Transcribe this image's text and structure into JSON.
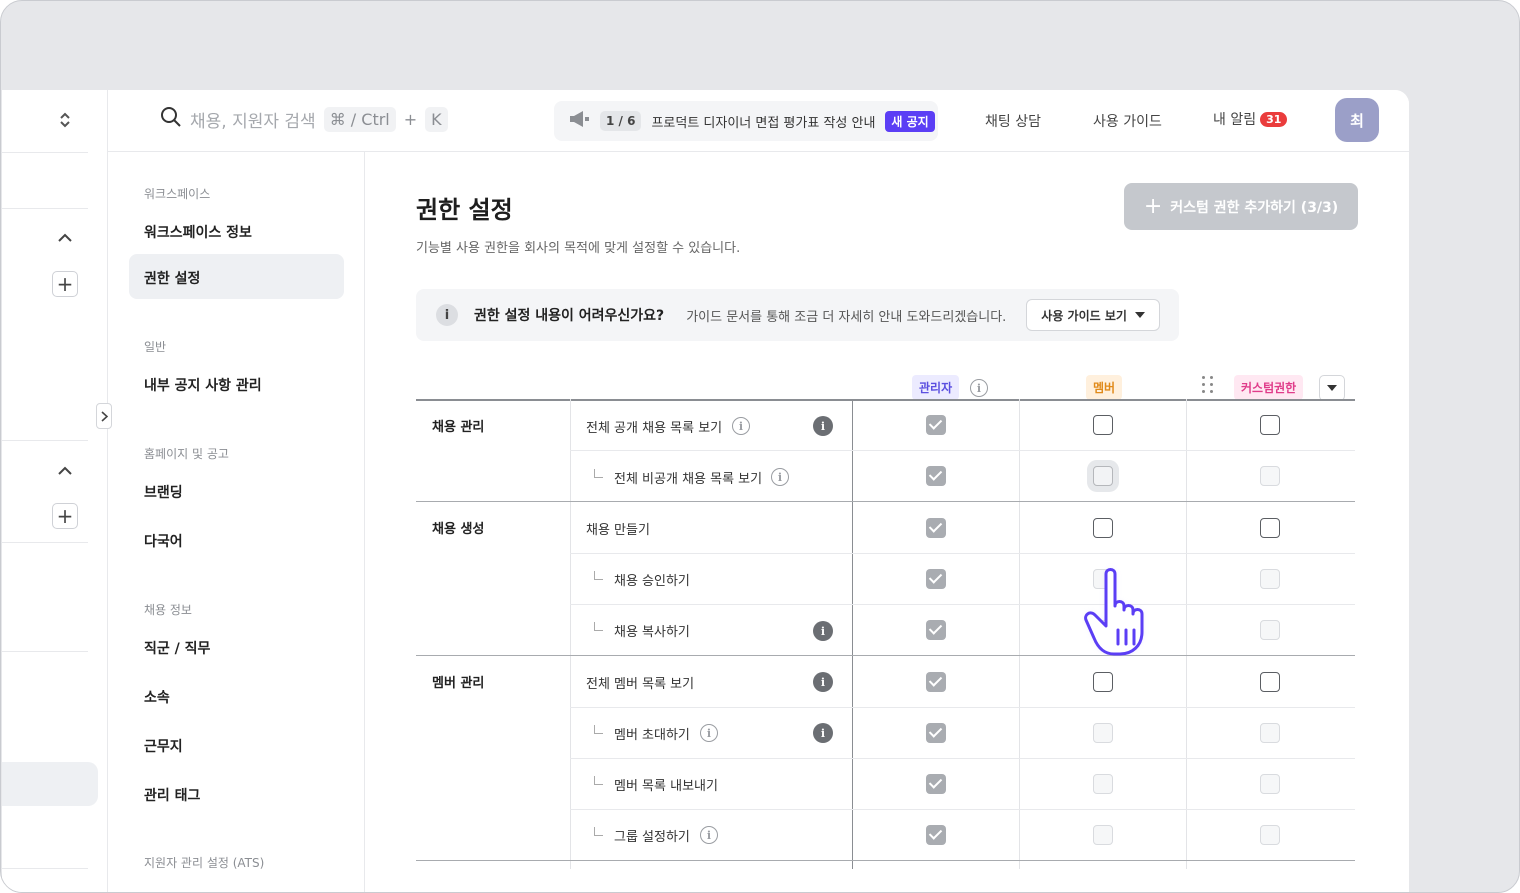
{
  "topbar": {
    "search_placeholder": "채용, 지원자 검색",
    "shortcut_key1": "⌘ / Ctrl",
    "shortcut_plus": "+",
    "shortcut_key2": "K",
    "notice_count": "1 / 6",
    "notice_text": "프로덕트 디자이너 면접 평가표 작성 안내",
    "notice_badge": "새 공지",
    "chat": "채팅 상담",
    "guide": "사용 가이드",
    "alerts": "내 알림",
    "alerts_count": "31",
    "avatar": "최"
  },
  "sidebar": {
    "group_workspace": "워크스페이스",
    "workspace_info": "워크스페이스 정보",
    "permission": "권한 설정",
    "group_general": "일반",
    "notice_manage": "내부 공지 사항 관리",
    "group_homepage": "홈페이지 및 공고",
    "branding": "브랜딩",
    "multilang": "다국어",
    "group_job": "채용 정보",
    "job_role": "직군 / 직무",
    "affiliation": "소속",
    "workplace": "근무지",
    "manage_tag": "관리 태그",
    "group_ats": "지원자 관리 설정 (ATS)"
  },
  "main": {
    "title": "권한 설정",
    "subtitle": "기능별 사용 권한을 회사의 목적에 맞게 설정할 수 있습니다.",
    "add_button": "커스텀 권한 추가하기 (3/3)",
    "help_question": "권한 설정 내용이 어려우신가요?",
    "help_desc": "가이드 문서를 통해 조금 더 자세히 안내 도와드리겠습니다.",
    "help_button": "사용 가이드 보기"
  },
  "roles": {
    "admin": "관리자",
    "member": "멤버",
    "custom": "커스텀권한"
  },
  "colors": {
    "accent": "#5b3ef5",
    "admin_chip_bg": "#ecebff",
    "admin_chip_fg": "#5b4fe0",
    "member_chip_bg": "#fff0dd",
    "member_chip_fg": "#e08a1a",
    "custom_chip_bg": "#ffe8f2",
    "custom_chip_fg": "#e03c8a"
  },
  "groups": {
    "g1": "채용 관리",
    "g2": "채용 생성",
    "g3": "멤버 관리"
  },
  "rows": {
    "r1": "전체 공개 채용 목록 보기",
    "r2": "전체 비공개 채용 목록 보기",
    "r3": "채용 만들기",
    "r4": "채용 승인하기",
    "r5": "채용 복사하기",
    "r6": "전체 멤버 목록 보기",
    "r7": "멤버 초대하기",
    "r8": "멤버 목록 내보내기",
    "r9": "그룹 설정하기"
  },
  "permissions": [
    {
      "admin": "checked",
      "member": "unchecked",
      "custom": "unchecked"
    },
    {
      "admin": "checked",
      "member": "hover",
      "custom": "disabled"
    },
    {
      "admin": "checked",
      "member": "unchecked",
      "custom": "unchecked"
    },
    {
      "admin": "checked",
      "member": "disabled",
      "custom": "disabled"
    },
    {
      "admin": "checked",
      "member": "disabled",
      "custom": "disabled"
    },
    {
      "admin": "checked",
      "member": "unchecked",
      "custom": "unchecked"
    },
    {
      "admin": "checked",
      "member": "disabled",
      "custom": "disabled"
    },
    {
      "admin": "checked",
      "member": "disabled",
      "custom": "disabled"
    },
    {
      "admin": "checked",
      "member": "disabled",
      "custom": "disabled"
    }
  ]
}
